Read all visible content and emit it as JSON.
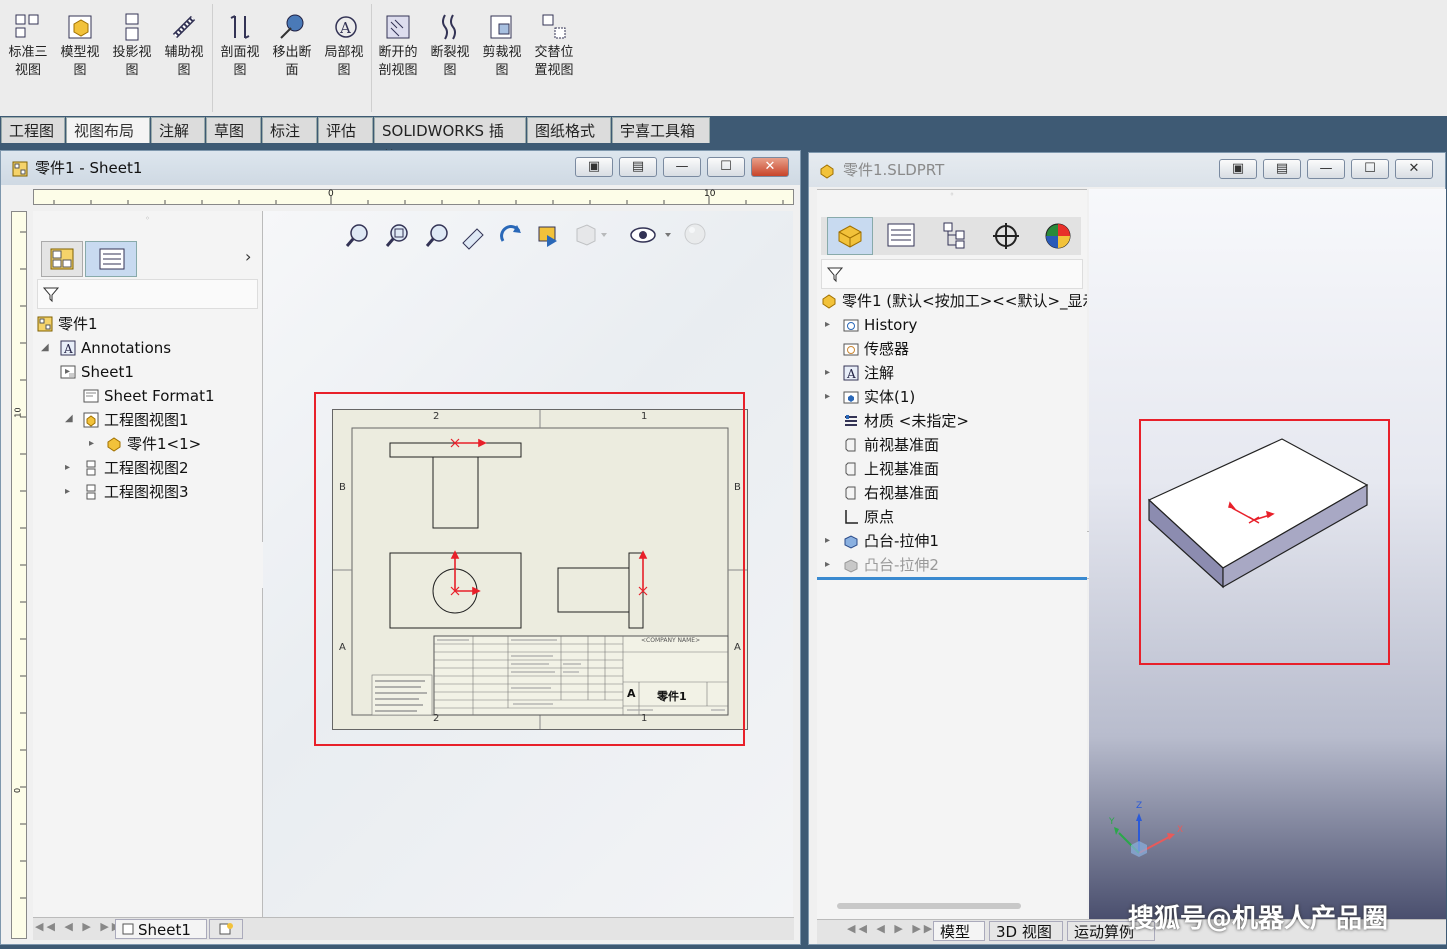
{
  "ribbon": {
    "buttons": [
      {
        "l1": "标准三",
        "l2": "视图"
      },
      {
        "l1": "模型视",
        "l2": "图"
      },
      {
        "l1": "投影视",
        "l2": "图"
      },
      {
        "l1": "辅助视",
        "l2": "图"
      },
      {
        "l1": "剖面视",
        "l2": "图"
      },
      {
        "l1": "移出断",
        "l2": "面"
      },
      {
        "l1": "局部视",
        "l2": "图"
      },
      {
        "l1": "断开的",
        "l2": "剖视图"
      },
      {
        "l1": "断裂视",
        "l2": "图"
      },
      {
        "l1": "剪裁视",
        "l2": "图"
      },
      {
        "l1": "交替位",
        "l2": "置视图"
      }
    ]
  },
  "tabs": [
    "工程图",
    "视图布局",
    "注解",
    "草图",
    "标注",
    "评估",
    "SOLIDWORKS 插件",
    "图纸格式",
    "宇喜工具箱"
  ],
  "left_window": {
    "title": "零件1 - Sheet1",
    "ruler": {
      "t0": "0",
      "t10": "10",
      "v10": "10",
      "v0": "0"
    },
    "tree": {
      "root": "零件1",
      "annotations": "Annotations",
      "sheet": "Sheet1",
      "sheet_format": "Sheet Format1",
      "view1": "工程图视图1",
      "part_ref": "零件1<1>",
      "view2": "工程图视图2",
      "view3": "工程图视图3"
    },
    "drawing": {
      "col2": "2",
      "col1": "1",
      "rowB": "B",
      "rowA": "A",
      "company": "<COMPANY NAME>",
      "size": "A",
      "part_name": "零件1"
    },
    "bottom_tab": "Sheet1"
  },
  "right_window": {
    "title": "零件1.SLDPRT",
    "tree": {
      "root": "零件1 (默认<按加工><<默认>_显示",
      "history": "History",
      "sensors": "传感器",
      "annotations": "注解",
      "solid": "实体(1)",
      "material": "材质 <未指定>",
      "front_plane": "前视基准面",
      "top_plane": "上视基准面",
      "right_plane": "右视基准面",
      "origin": "原点",
      "boss1": "凸台-拉伸1",
      "boss2": "凸台-拉伸2"
    },
    "bottom_tabs": [
      "模型",
      "3D 视图",
      "运动算例"
    ],
    "triad": {
      "z": "Z",
      "x": "X",
      "y": "Y"
    }
  },
  "watermark": "搜狐号@机器人产品圈",
  "colors": {
    "highlight": "#e8202a",
    "accent": "#3e5a74"
  }
}
